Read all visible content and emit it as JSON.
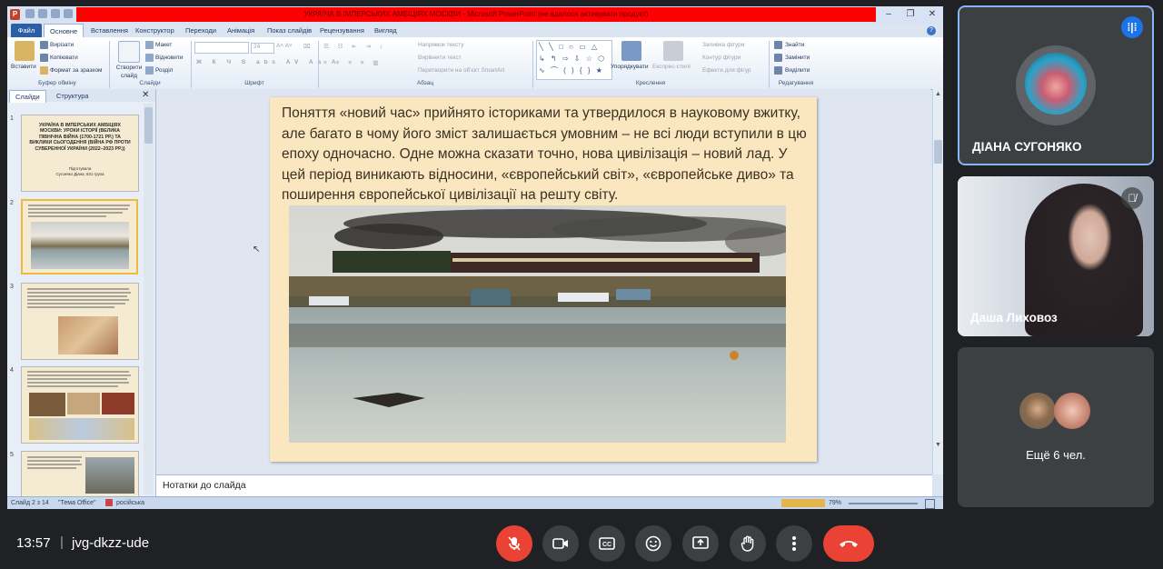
{
  "ppt": {
    "window_title": "УКРАЇНА В ІМПЕРСЬКИХ АМБІЦІЯХ МОСКВИ - Microsoft PowerPoint (не вдалося активувати продукт)",
    "tabs": [
      "Вставлення",
      "Конструктор",
      "Переходи",
      "Анімація",
      "Показ слайдів",
      "Рецензування",
      "Вигляд"
    ],
    "file_tab": "Файл",
    "home_tab": "Основне",
    "ribbon": {
      "paste": "Вставити",
      "cut": "Вирізати",
      "copy": "Копіювати",
      "format_painter": "Формат за зразком",
      "clipboard_group": "Буфер обміну",
      "new_slide": "Створити слайд",
      "layout": "Макет",
      "reset": "Відновити",
      "section": "Розділ",
      "slides_group": "Слайди",
      "font_size": "24",
      "font_group": "Шрифт",
      "text_direction": "Напрямок тексту",
      "align_text": "Вирівняти текст",
      "convert_smartart": "Перетворити на об'єкт SmartArt",
      "paragraph_group": "Абзац",
      "arrange": "Упорядкувати",
      "quick_styles": "Експрес-стилі",
      "shape_fill": "Заливка фігури",
      "shape_outline": "Контур фігури",
      "shape_effects": "Ефекти для фігур",
      "drawing_group": "Креслення",
      "find": "Знайти",
      "replace": "Замінити",
      "select": "Виділити",
      "editing_group": "Редагування"
    },
    "pane_tabs": {
      "slides": "Слайди",
      "outline": "Структура"
    },
    "thumb1": {
      "number": "1",
      "title": "УКРАЇНА В ІМПЕРСЬКИХ АМБІЦІЯХ МОСКВИ: УРОКИ ІСТОРІЇ (ВЕЛИКА ПІВНІЧНА ВІЙНА (1700-1721 РР.) ТА ВИКЛИКИ СЬОГОДЕННЯ (ВІЙНА РФ ПРОТИ СУВЕРЕННОЇ УКРАЇНИ (2022–2023 РР.))",
      "subtitle": "Підготувала",
      "author": "Сугоняко Діана, 831 група"
    },
    "thumb_numbers": [
      "2",
      "3",
      "4",
      "5"
    ],
    "slide_text": "Поняття «новий час» прийнято істориками та утвердилося в науковому вжитку, але багато в чому його зміст залишається умовним – не всі люди вступили в цю епоху одночасно. Одне можна сказати точно, нова цивілізація – новий лад. У цей період виникають відносини, «європейський світ», «європейське диво» та поширення європейської цивілізації на решту світу.",
    "notes_placeholder": "Нотатки до слайда",
    "status": {
      "slide_counter": "Слайд 2 з 14",
      "theme": "\"Тема Office\"",
      "language": "російська",
      "zoom": "79%"
    }
  },
  "participants": {
    "top": {
      "name": "ДІАНА СУГОНЯКО"
    },
    "middle": {
      "name": "Даша Лиховоз"
    },
    "more": {
      "label": "Ещё 6 чел."
    }
  },
  "meeting": {
    "time": "13:57",
    "separator": "|",
    "code": "jvg-dkzz-ude"
  },
  "colors": {
    "end_call": "#ea4335",
    "mic_off": "#ea4335",
    "active_speaker_border": "#8ab4f8",
    "ppt_title_bar": "#ff0000"
  },
  "icons": [
    "mic-off-icon",
    "camera-icon",
    "captions-icon",
    "emoji-icon",
    "present-icon",
    "raise-hand-icon",
    "more-icon",
    "end-call-icon",
    "audio-active-icon",
    "mic-muted-icon"
  ]
}
